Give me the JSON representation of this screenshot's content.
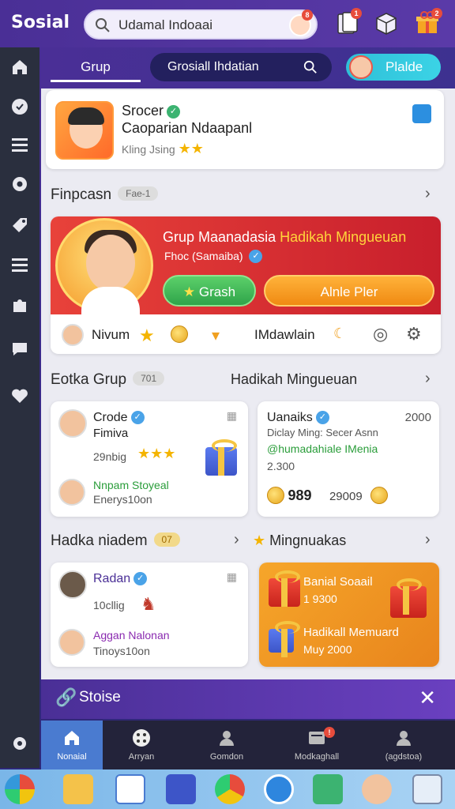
{
  "app": {
    "title": "Sosial"
  },
  "search": {
    "value": "Udamal Indoaai",
    "badge": "8"
  },
  "topbar": {
    "badges": [
      "1",
      "2"
    ]
  },
  "tabs": {
    "tab1": "Grup",
    "tab2": "Grosiall Ihdatian",
    "tab3": "Plalde"
  },
  "profile": {
    "name": "Srocer",
    "subtitle": "Caoparian Ndaapanl",
    "meta": "Kling Jsing"
  },
  "section1": {
    "title": "Finpcasn",
    "pill": "Fae-1"
  },
  "promo": {
    "title_a": "Grup Maanadasia ",
    "title_b": "Hadikah Mingueuan",
    "subtitle": "Fhoc (Samaiba)",
    "btn_green": "Grash",
    "btn_orange": "Alnle Pler",
    "row_label1": "Nivum",
    "row_label2": "IMdawlain"
  },
  "section2": {
    "title": "Eotka Grup",
    "pill": "701",
    "right_title": "Hadikah Mingueuan"
  },
  "card_a": {
    "name": "Crode",
    "sub": "Fimiva",
    "meta": "29nbig",
    "friend_name": "Nnpam Stoyeal",
    "friend_meta": "Enerys10on"
  },
  "card_b": {
    "name": "Uanaiks",
    "count": "2000",
    "desc": "Diclay Ming: Secer Asnn",
    "handle": "@humadahiale IMenia",
    "num": "2.300",
    "coins": "989",
    "coins_b": "29009"
  },
  "section3": {
    "title": "Hadka niadem",
    "pill": "07",
    "right_title": "Mingnuakas"
  },
  "card_c": {
    "name": "Radan",
    "meta": "10cllig",
    "friend_name": "Aggan Nalonan",
    "friend_meta": "Tinoys10on"
  },
  "card_d": {
    "title1": "Banial Soaail",
    "num1": "1 9300",
    "title2": "Hadikall Memuard",
    "num2": "Muy 2000"
  },
  "bottomstrip": {
    "label": "Stoise"
  },
  "nav": [
    {
      "label": "Nonaial"
    },
    {
      "label": "Arryan"
    },
    {
      "label": "Gomdon"
    },
    {
      "label": "Modkaghall"
    },
    {
      "label": "(agdstoa)"
    }
  ],
  "colors": {
    "accent": "#4a2f96",
    "promo_red": "#e8423a",
    "green": "#3cb371",
    "orange": "#f08a12"
  }
}
